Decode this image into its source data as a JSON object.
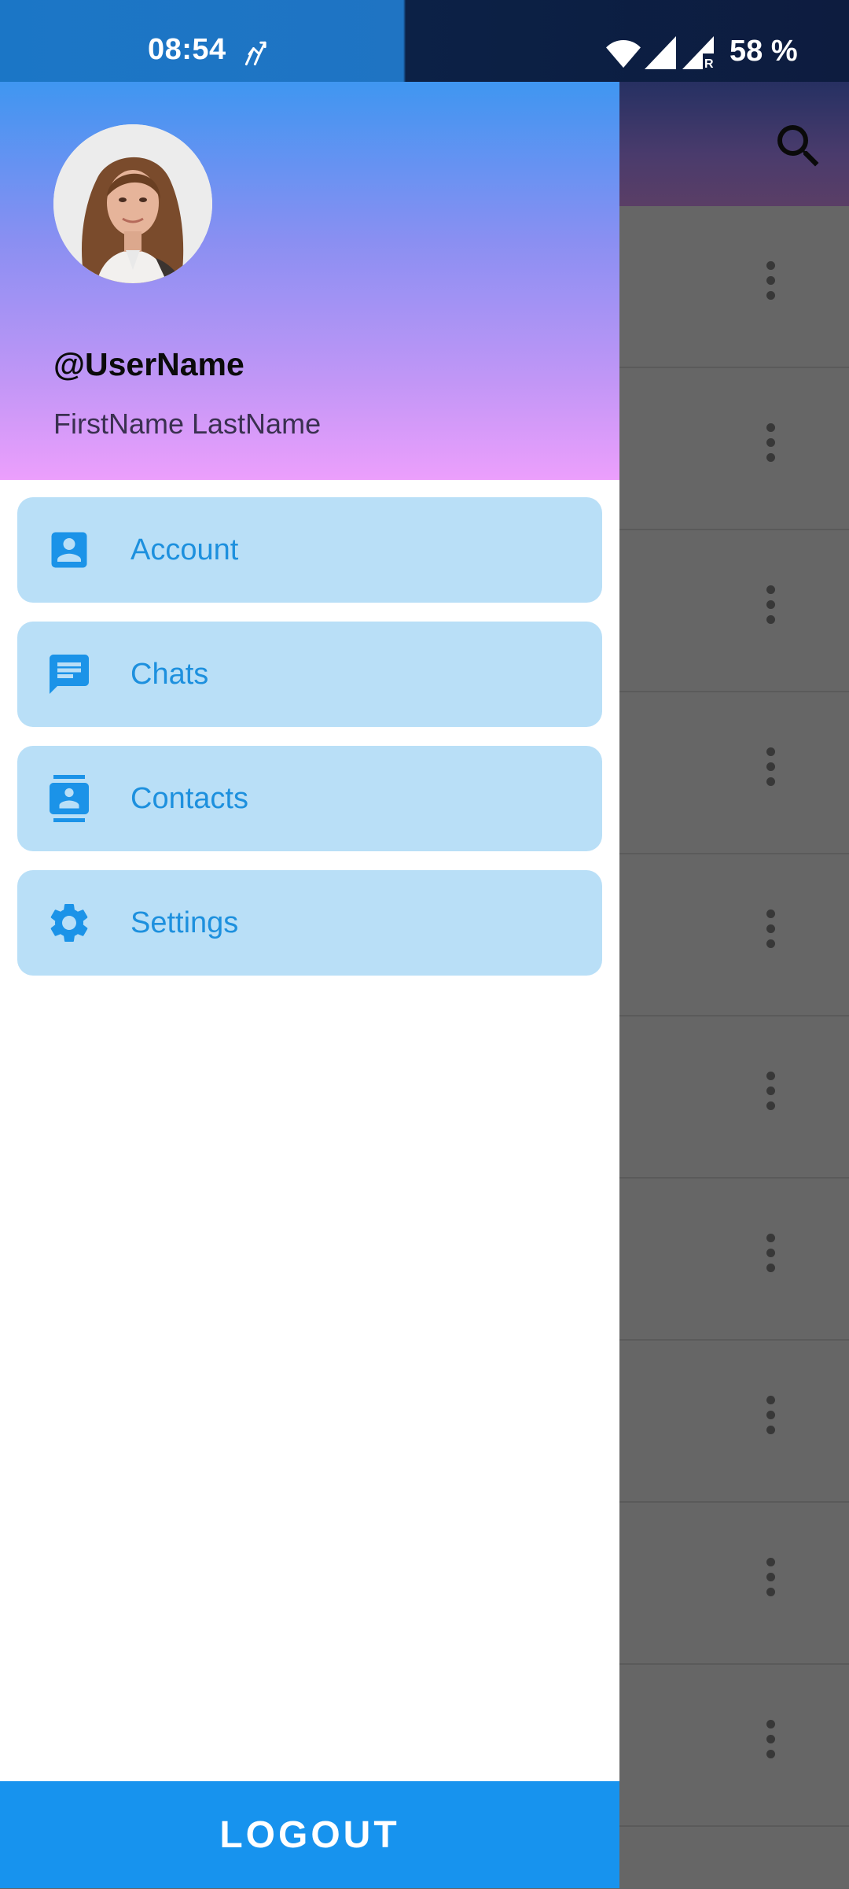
{
  "status_bar": {
    "time": "08:54",
    "battery": "58 %",
    "icons": [
      "data-transfer-icon",
      "wifi-icon",
      "signal-icon",
      "signal-roaming-icon"
    ]
  },
  "drawer": {
    "username": "@UserName",
    "full_name": "FirstName LastName",
    "menu": [
      {
        "label": "Account",
        "icon": "account-box-icon"
      },
      {
        "label": "Chats",
        "icon": "chat-icon"
      },
      {
        "label": "Contacts",
        "icon": "contacts-icon"
      },
      {
        "label": "Settings",
        "icon": "gear-icon"
      }
    ],
    "logout_label": "LOGOUT"
  },
  "colors": {
    "menu_item_bg": "#b9dff7",
    "menu_text": "#1d90de",
    "logout_bg": "#1793ee",
    "scrim": "#666666"
  },
  "background_app": {
    "search_icon": "search-icon",
    "row_action_icon": "more-vert-icon",
    "visible_rows": 10
  }
}
